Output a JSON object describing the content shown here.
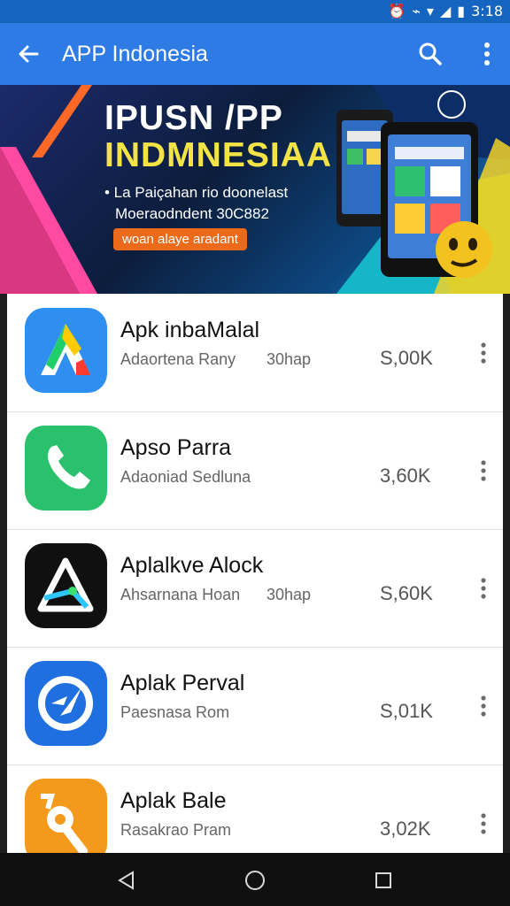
{
  "status_bar": {
    "time": "3:18",
    "icons": [
      "alarm-off-icon",
      "vibrate-icon",
      "wifi-icon",
      "signal-icon",
      "battery-icon"
    ]
  },
  "app_bar": {
    "title": "APP Indonesia",
    "icons": [
      "back-arrow-icon",
      "search-icon",
      "more-vert-icon"
    ]
  },
  "banner": {
    "title_line1": "IPUSN /PP",
    "title_line2": "INDMNESIAA",
    "subtitle_line1": "• La Paiçahan rio doonelast",
    "subtitle_line2": "Moeraodndent 30C882",
    "button_label": "woan alaye aradant"
  },
  "apps": [
    {
      "name": "Apk inbaMalal",
      "developer": "Adaortena Rany",
      "extra": "30hap",
      "rating": "S,00K",
      "icon": "triangle-a-blue-icon"
    },
    {
      "name": "Apso Parra",
      "developer": "Adaoniad Sedluna",
      "extra": "",
      "rating": "3,60K",
      "icon": "phone-call-icon"
    },
    {
      "name": "Aplalkve Alock",
      "developer": "Ahsarnana Hoan",
      "extra": "30hap",
      "rating": "S,60K",
      "icon": "triangle-a-black-icon"
    },
    {
      "name": "Aplak Perval",
      "developer": "Paesnasa Rom",
      "extra": "",
      "rating": "S,01K",
      "icon": "compass-refresh-icon"
    },
    {
      "name": "Aplak Bale",
      "developer": "Rasakrao Pram",
      "extra": "",
      "rating": "3,02K",
      "icon": "tools-orange-icon"
    }
  ],
  "nav_bar": {
    "icons": [
      "back-triangle-icon",
      "home-circle-icon",
      "recents-square-icon"
    ]
  },
  "colors": {
    "status_bar": "#1565c0",
    "app_bar": "#2f7be6",
    "banner_yellow": "#f3e347",
    "banner_orange": "#ec6b1b",
    "nav_bar": "#101010"
  }
}
